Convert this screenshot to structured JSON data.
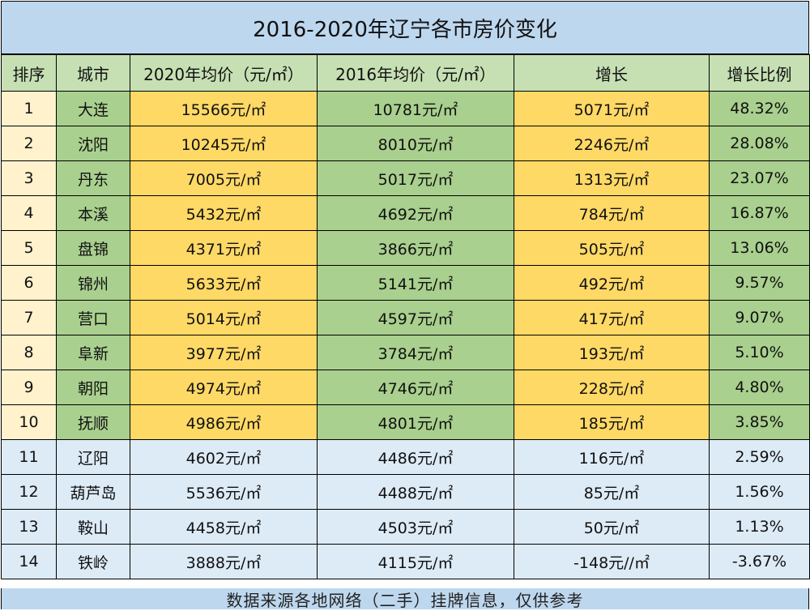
{
  "title": "2016-2020年辽宁各市房价变化",
  "headers": [
    "排序",
    "城市",
    "2020年均价（元/㎡）",
    "2016年均价（元/㎡）",
    "增长",
    "增长比例"
  ],
  "rows": [
    {
      "rank": "1",
      "city": "大连",
      "p2020": "15566元/㎡",
      "p2016": "10781元/㎡",
      "growth": "5071元/㎡",
      "ratio": "48.32%"
    },
    {
      "rank": "2",
      "city": "沈阳",
      "p2020": "10245元/㎡",
      "p2016": "8010元/㎡",
      "growth": "2246元/㎡",
      "ratio": "28.08%"
    },
    {
      "rank": "3",
      "city": "丹东",
      "p2020": "7005元/㎡",
      "p2016": "5017元/㎡",
      "growth": "1313元/㎡",
      "ratio": "23.07%"
    },
    {
      "rank": "4",
      "city": "本溪",
      "p2020": "5432元/㎡",
      "p2016": "4692元/㎡",
      "growth": "784元/㎡",
      "ratio": "16.87%"
    },
    {
      "rank": "5",
      "city": "盘锦",
      "p2020": "4371元/㎡",
      "p2016": "3866元/㎡",
      "growth": "505元/㎡",
      "ratio": "13.06%"
    },
    {
      "rank": "6",
      "city": "锦州",
      "p2020": "5633元/㎡",
      "p2016": "5141元/㎡",
      "growth": "492元/㎡",
      "ratio": "9.57%"
    },
    {
      "rank": "7",
      "city": "营口",
      "p2020": "5014元/㎡",
      "p2016": "4597元/㎡",
      "growth": "417元/㎡",
      "ratio": "9.07%"
    },
    {
      "rank": "8",
      "city": "阜新",
      "p2020": "3977元/㎡",
      "p2016": "3784元/㎡",
      "growth": "193元/㎡",
      "ratio": "5.10%"
    },
    {
      "rank": "9",
      "city": "朝阳",
      "p2020": "4974元/㎡",
      "p2016": "4746元/㎡",
      "growth": "228元/㎡",
      "ratio": "4.80%"
    },
    {
      "rank": "10",
      "city": "抚顺",
      "p2020": "4986元/㎡",
      "p2016": "4801元/㎡",
      "growth": "185元/㎡",
      "ratio": "3.85%"
    },
    {
      "rank": "11",
      "city": "辽阳",
      "p2020": "4602元/㎡",
      "p2016": "4486元/㎡",
      "growth": "116元/㎡",
      "ratio": "2.59%"
    },
    {
      "rank": "12",
      "city": "葫芦岛",
      "p2020": "5536元/㎡",
      "p2016": "4488元/㎡",
      "growth": "85元/㎡",
      "ratio": "1.56%"
    },
    {
      "rank": "13",
      "city": "鞍山",
      "p2020": "4458元/㎡",
      "p2016": "4503元/㎡",
      "growth": "50元/㎡",
      "ratio": "1.13%"
    },
    {
      "rank": "14",
      "city": "铁岭",
      "p2020": "3888元/㎡",
      "p2016": "4115元/㎡",
      "growth": "-148元//㎡",
      "ratio": "-3.67%"
    }
  ],
  "footer": "数据来源各地网络（二手）挂牌信息，仅供参考",
  "colors": {
    "title_bg": "#bdd7ee",
    "header_bg": "#c6e0b4",
    "rank_bg": "#fff2cc",
    "green_bg": "#a9d08e",
    "gold_bg": "#ffd966",
    "blue_bg": "#ddebf7"
  }
}
